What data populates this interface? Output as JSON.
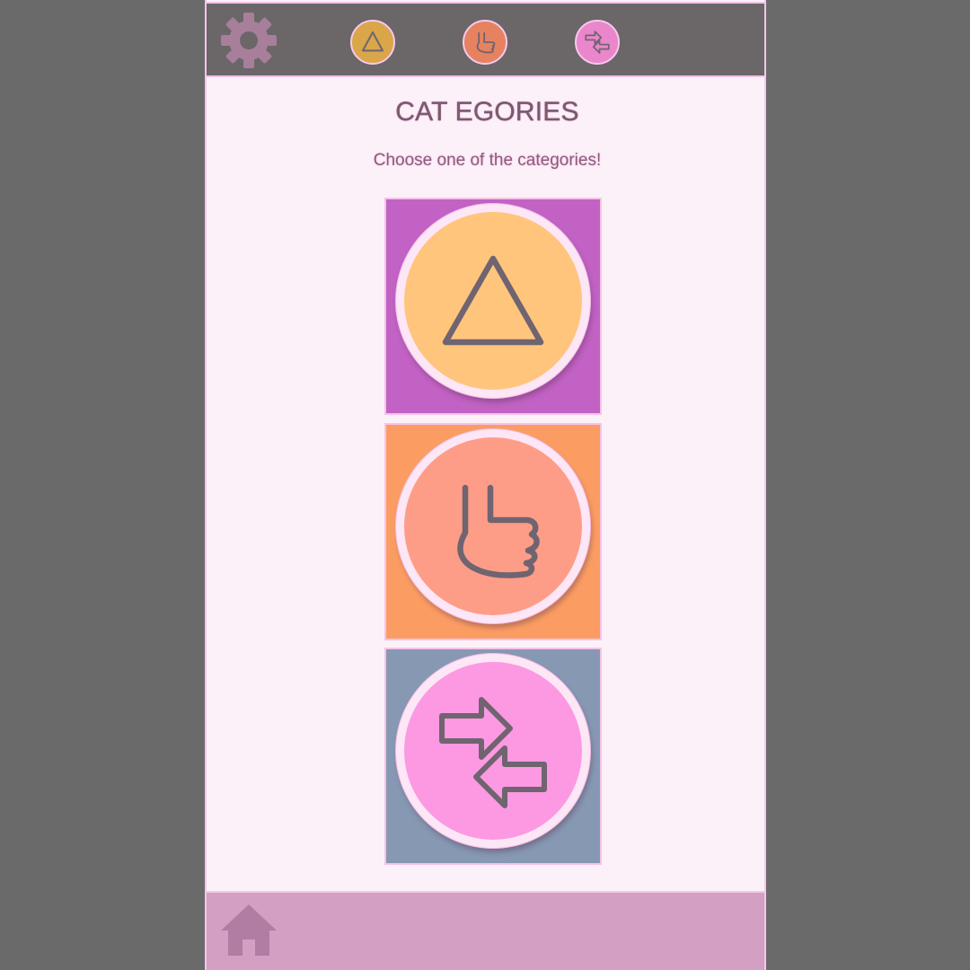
{
  "header": {
    "settings_icon": "gear-icon",
    "nav": [
      {
        "icon": "triangle-icon",
        "color": "#d9a649"
      },
      {
        "icon": "foot-icon",
        "color": "#e78260"
      },
      {
        "icon": "swap-arrows-icon",
        "color": "#ea86cb"
      }
    ]
  },
  "main": {
    "title": "CAT EGORIES",
    "subtitle": "Choose one of the categories!",
    "categories": [
      {
        "icon": "triangle-icon",
        "tile_color": "#c162c4",
        "disc_color": "#ffc57c"
      },
      {
        "icon": "foot-icon",
        "tile_color": "#fb9d63",
        "disc_color": "#fe9d87"
      },
      {
        "icon": "swap-arrows-icon",
        "tile_color": "#8798b3",
        "disc_color": "#fc99e2"
      }
    ]
  },
  "footer": {
    "home_icon": "home-icon"
  },
  "colors": {
    "background": "#6a6a6a",
    "panel": "#fdf1f9",
    "topbar": "#6b6668",
    "bottombar": "#d39fc2",
    "icon_stroke": "#6f6470"
  }
}
